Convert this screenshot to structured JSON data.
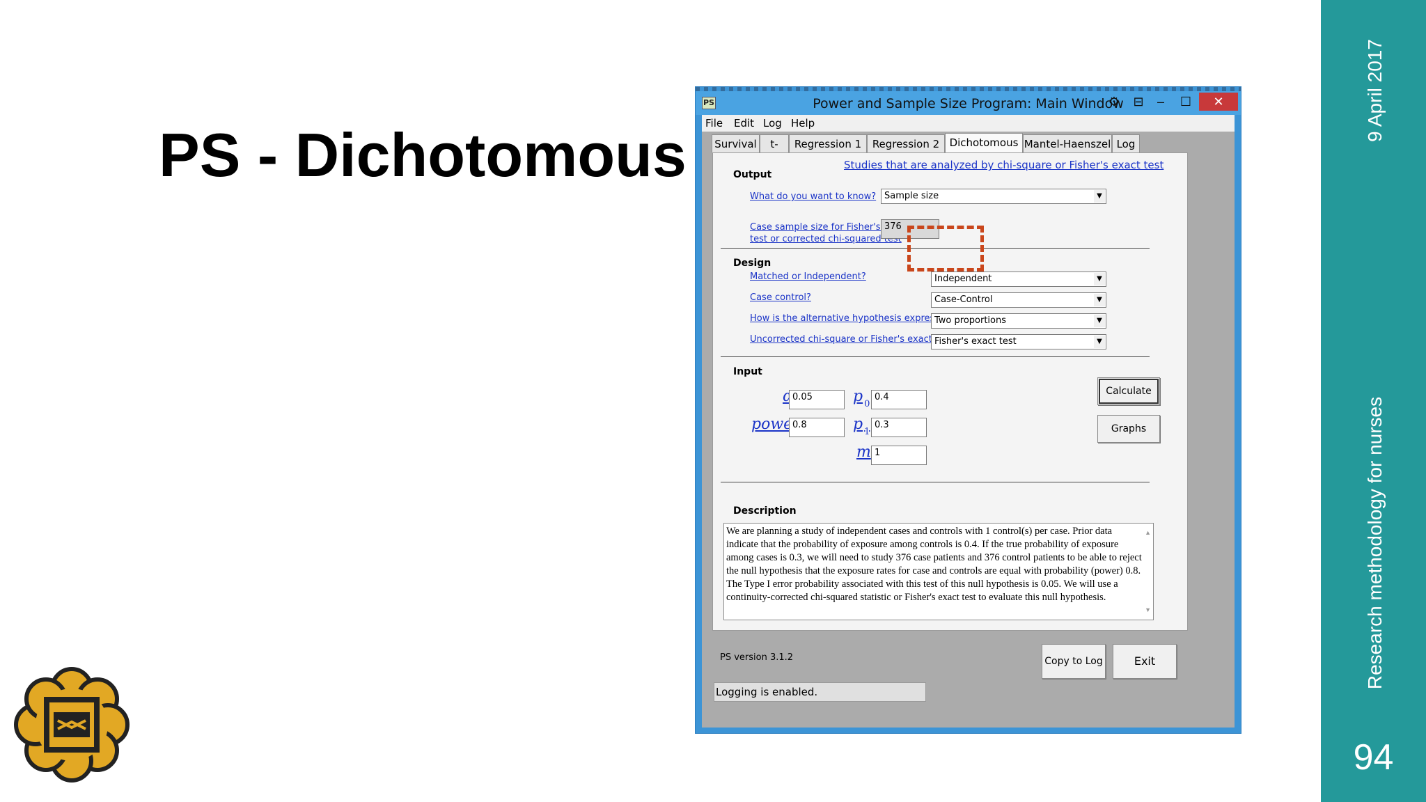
{
  "slide": {
    "title": "PS - Dichotomous",
    "date": "9 April 2017",
    "course": "Research methodology for nurses",
    "page_number": "94",
    "accent_color": "#24999a"
  },
  "window": {
    "app_icon": "PS",
    "title": "Power and Sample Size Program:  Main Window",
    "close_label": "✕",
    "maximize_label": "☐",
    "minimize_label": "–",
    "restore_label": "⊟",
    "settings_label": "⚙"
  },
  "menu": [
    "File",
    "Edit",
    "Log",
    "Help"
  ],
  "tabs": [
    "Survival",
    "t-test",
    "Regression 1",
    "Regression 2",
    "Dichotomous",
    "Mantel-Haenszel",
    "Log"
  ],
  "active_tab": "Dichotomous",
  "panel": {
    "top_link": "Studies that are analyzed by chi-square or Fisher's exact test",
    "output": {
      "heading": "Output",
      "question_label": "What do you want to know?",
      "question_value": "Sample size",
      "result_label_1": "Case sample size for Fisher's exact",
      "result_label_2": "test or corrected chi-squared test",
      "result_value": "376"
    },
    "design": {
      "heading": "Design",
      "matched_label": "Matched or Independent?",
      "matched_value": "Independent",
      "case_control_label": "Case control?",
      "case_control_value": "Case-Control",
      "hypothesis_label": "How is the alternative hypothesis expressed?",
      "hypothesis_value": "Two proportions",
      "test_label": "Uncorrected chi-square or Fisher's exact test?",
      "test_value": "Fisher's exact test"
    },
    "input": {
      "heading": "Input",
      "alpha_symbol": "α",
      "alpha_value": "0.05",
      "power_symbol": "power",
      "power_value": "0.8",
      "p_symbol": "p",
      "p0_sub": "0",
      "p0_value": "0.4",
      "p1_sub": "1",
      "p1_value": "0.3",
      "m_symbol": "m",
      "m_value": "1",
      "calculate_label": "Calculate",
      "graphs_label": "Graphs"
    },
    "description": {
      "heading": "Description",
      "text": "We are planning a study of independent cases and controls with 1 control(s) per case. Prior data indicate that the probability of exposure among controls is 0.4.  If the true probability of exposure among cases is 0.3, we will need to study  376 case patients and 376 control patients to be able to reject the null hypothesis that the exposure rates for case and controls are equal with probability (power) 0.8.  The Type I error probability associated with this test of this null hypothesis is 0.05.  We will use a continuity-corrected chi-squared statistic or Fisher's exact test to evaluate this null hypothesis."
    }
  },
  "footer": {
    "version": "PS version 3.1.2",
    "copy_label": "Copy to Log",
    "exit_label": "Exit",
    "status": "Logging is enabled."
  }
}
